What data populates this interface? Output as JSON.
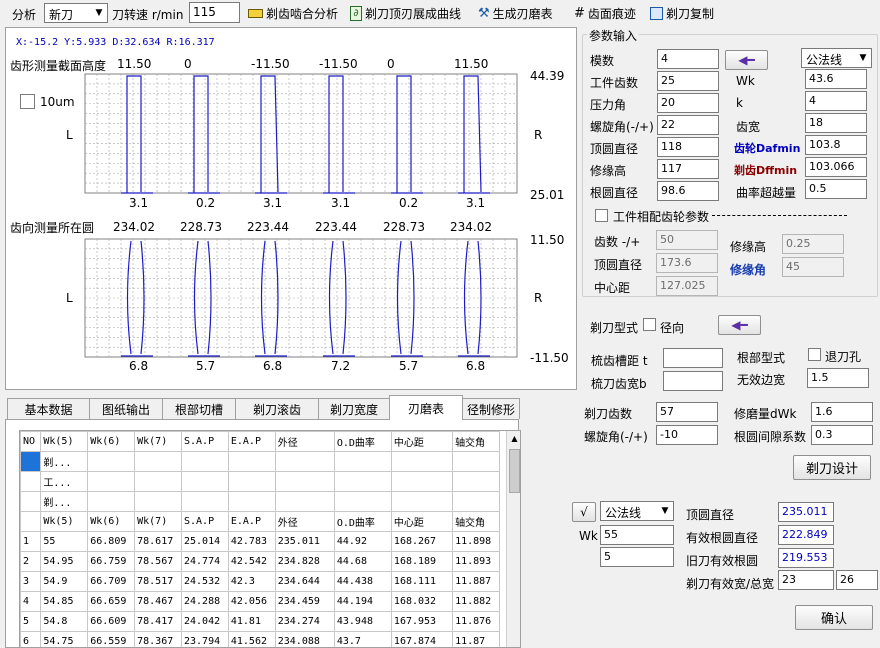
{
  "toolbar": {
    "analysis_label": "分析",
    "mode_value": "新刀",
    "speed_label": "刀转速 r/min",
    "speed_value": "115",
    "btn_mesh": "剃齿啮合分析",
    "btn_curve": "剃刀顶刃展成曲线",
    "btn_table": "生成刃磨表",
    "btn_trace": "齿面痕迹",
    "btn_copy": "剃刀复制"
  },
  "chart": {
    "readout": "X:-15.2  Y:5.933  D:32.634  R:16.317",
    "top_title": "齿形测量截面高度",
    "top_values": [
      "11.50",
      "0",
      "-11.50",
      "-11.50",
      "0",
      "11.50"
    ],
    "top_ymax": "44.39",
    "top_ymin": "25.01",
    "top_bottom": [
      "3.1",
      "0.2",
      "3.1",
      "3.1",
      "0.2",
      "3.1"
    ],
    "scale_label": "10um",
    "left_label": "L",
    "right_label": "R",
    "bottom_title": "齿向测量所在圆",
    "bottom_values": [
      "234.02",
      "228.73",
      "223.44",
      "223.44",
      "228.73",
      "234.02"
    ],
    "bottom_ymax": "11.50",
    "bottom_ymin": "-11.50",
    "bottom_bottom": [
      "6.8",
      "5.7",
      "6.8",
      "7.2",
      "5.7",
      "6.8"
    ]
  },
  "params": {
    "group_title": "参数输入",
    "module_label": "模数",
    "module": "4",
    "teeth_label": "工件齿数",
    "teeth": "25",
    "pressure_label": "压力角",
    "pressure": "20",
    "helix_label": "螺旋角(-/+)",
    "helix": "22",
    "tip_label": "顶圆直径",
    "tip": "118",
    "edge_label": "修缘高",
    "edge": "117",
    "root_label": "根圆直径",
    "root": "98.6",
    "method_value": "公法线",
    "wk_label": "Wk",
    "wk": "43.6",
    "k_label": "k",
    "k": "4",
    "width_label": "齿宽",
    "width": "18",
    "gear_d_label": "齿轮Dafmin",
    "gear_d": "103.8",
    "shave_d_label": "剃齿Dffmin",
    "shave_d": "103.066",
    "crown_label": "曲率超越量",
    "crown": "0.5",
    "mate_label": "工件相配齿轮参数",
    "mate_teeth_label": "齿数 -/+",
    "mate_teeth": "50",
    "mate_tip_label": "顶圆直径",
    "mate_tip": "173.6",
    "center_label": "中心距",
    "center": "127.025",
    "mate_edge_label": "修缘高",
    "mate_edge": "0.25",
    "mate_angle_label": "修缘角",
    "mate_angle": "45"
  },
  "cutter": {
    "type_label": "剃刀型式",
    "radial_label": "径向",
    "groove_label": "梳齿槽距 t",
    "comb_label": "梳刀齿宽b",
    "root_type_label": "根部型式",
    "relief_label": "退刀孔",
    "invalid_label": "无效边宽",
    "invalid": "1.5",
    "teeth_label": "剃刀齿数",
    "teeth": "57",
    "helix_label": "螺旋角(-/+)",
    "helix": "-10",
    "dwk_label": "修磨量dWk",
    "dwk": "1.6",
    "clear_label": "根圆间隙系数",
    "clear": "0.3",
    "design_btn": "剃刀设计"
  },
  "result": {
    "method_value": "公法线",
    "wk_label": "Wk",
    "wk1": "55",
    "wk2": "5",
    "tip_label": "顶圆直径",
    "tip": "235.011",
    "eff_root_label": "有效根圆直径",
    "eff_root": "222.849",
    "old_root_label": "旧刀有效根圆",
    "old_root": "219.553",
    "eff_width_label": "剃刀有效宽/总宽",
    "eff_width": "23",
    "total_width": "26",
    "ok_btn": "确认"
  },
  "tabs": [
    "基本数据",
    "图纸输出",
    "根部切槽",
    "剃刀滚齿",
    "剃刀宽度",
    "刃磨表",
    "径制修形"
  ],
  "table": {
    "headers": [
      "NO",
      "Wk(5)",
      "Wk(6)",
      "Wk(7)",
      "S.A.P",
      "E.A.P",
      "外径",
      "O.D曲率",
      "中心距",
      "轴交角"
    ],
    "meta_rows": [
      [
        "",
        "剃..."
      ],
      [
        "",
        "工..."
      ],
      [
        "",
        "剃..."
      ]
    ],
    "sub_headers": [
      "",
      "Wk(5)",
      "Wk(6)",
      "Wk(7)",
      "S.A.P",
      "E.A.P",
      "外径",
      "O.D曲率",
      "中心距",
      "轴交角"
    ],
    "rows": [
      [
        "1",
        "55",
        "66.809",
        "78.617",
        "25.014",
        "42.783",
        "235.011",
        "44.92",
        "168.267",
        "11.898"
      ],
      [
        "2",
        "54.95",
        "66.759",
        "78.567",
        "24.774",
        "42.542",
        "234.828",
        "44.68",
        "168.189",
        "11.893"
      ],
      [
        "3",
        "54.9",
        "66.709",
        "78.517",
        "24.532",
        "42.3",
        "234.644",
        "44.438",
        "168.111",
        "11.887"
      ],
      [
        "4",
        "54.85",
        "66.659",
        "78.467",
        "24.288",
        "42.056",
        "234.459",
        "44.194",
        "168.032",
        "11.882"
      ],
      [
        "5",
        "54.8",
        "66.609",
        "78.417",
        "24.042",
        "41.81",
        "234.274",
        "43.948",
        "167.953",
        "11.876"
      ],
      [
        "6",
        "54.75",
        "66.559",
        "78.367",
        "23.794",
        "41.562",
        "234.088",
        "43.7",
        "167.874",
        "11.87"
      ]
    ]
  }
}
